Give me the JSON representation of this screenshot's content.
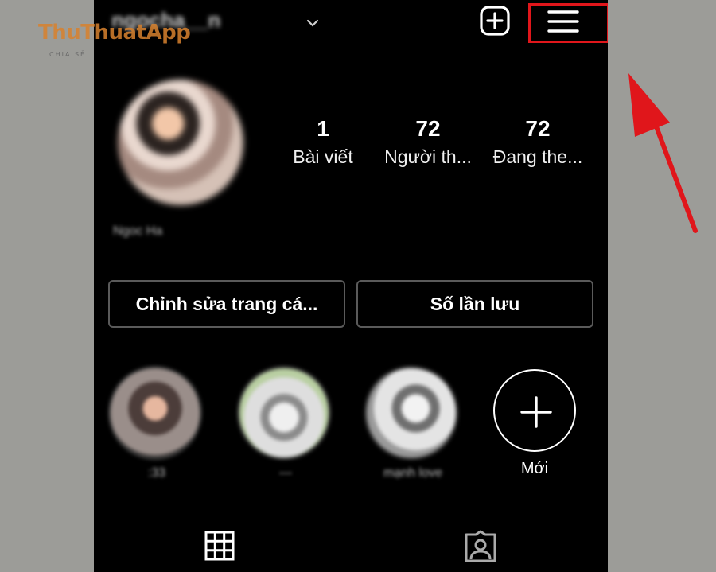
{
  "watermark": {
    "title": "ThuThuatApp",
    "subtitle": "CHIA SẺ"
  },
  "profile": {
    "username": "ngocha__n",
    "display_name": "Ngoc Ha"
  },
  "stats": [
    {
      "value": "1",
      "label": "Bài viết"
    },
    {
      "value": "72",
      "label": "Người th..."
    },
    {
      "value": "72",
      "label": "Đang the..."
    }
  ],
  "actions": {
    "edit_profile": "Chỉnh sửa trang cá...",
    "saved": "Số lần lưu"
  },
  "highlights": [
    {
      "label": ":33"
    },
    {
      "label": "---"
    },
    {
      "label": "mạnh love"
    }
  ],
  "new_highlight": {
    "label": "Mới"
  },
  "colors": {
    "annotation": "#e0161b",
    "watermark": "#d8822e",
    "background": "#9c9c98"
  },
  "icons": {
    "new_post": "plus-square-icon",
    "menu": "hamburger-menu-icon",
    "grid_tab": "grid-icon",
    "tagged_tab": "tagged-person-icon",
    "add_highlight": "plus-icon"
  }
}
